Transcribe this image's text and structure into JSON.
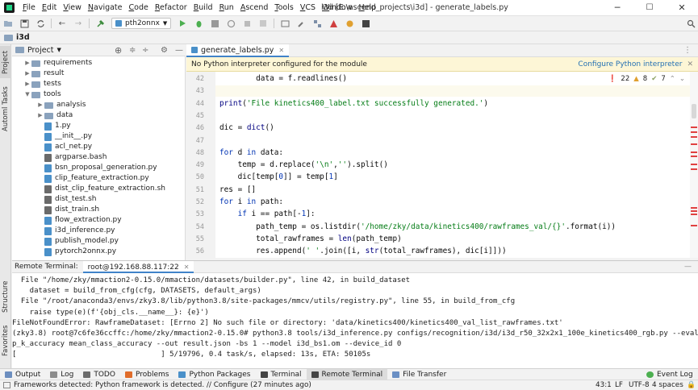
{
  "window": {
    "title": "i3d [E:\\ascend_projects\\i3d] - generate_labels.py",
    "menu": [
      "File",
      "Edit",
      "View",
      "Navigate",
      "Code",
      "Refactor",
      "Build",
      "Run",
      "Ascend",
      "Tools",
      "VCS",
      "Window",
      "Help"
    ],
    "minimize": "─",
    "maximize": "☐",
    "close": "✕"
  },
  "toolbar": {
    "run_config": "pth2onnx"
  },
  "breadcrumb": "i3d",
  "project_panel": {
    "title": "Project",
    "tree": [
      {
        "label": "requirements",
        "type": "folder",
        "indent": 1,
        "expanded": false
      },
      {
        "label": "result",
        "type": "folder",
        "indent": 1,
        "expanded": false
      },
      {
        "label": "tests",
        "type": "folder",
        "indent": 1,
        "expanded": false
      },
      {
        "label": "tools",
        "type": "folder",
        "indent": 1,
        "expanded": true
      },
      {
        "label": "analysis",
        "type": "folder",
        "indent": 2,
        "expanded": false
      },
      {
        "label": "data",
        "type": "folder",
        "indent": 2,
        "expanded": false
      },
      {
        "label": "1.py",
        "type": "py",
        "indent": 2
      },
      {
        "label": "__init__.py",
        "type": "py",
        "indent": 2
      },
      {
        "label": "acl_net.py",
        "type": "py",
        "indent": 2
      },
      {
        "label": "argparse.bash",
        "type": "sh",
        "indent": 2
      },
      {
        "label": "bsn_proposal_generation.py",
        "type": "py",
        "indent": 2
      },
      {
        "label": "clip_feature_extraction.py",
        "type": "py",
        "indent": 2
      },
      {
        "label": "dist_clip_feature_extraction.sh",
        "type": "sh",
        "indent": 2
      },
      {
        "label": "dist_test.sh",
        "type": "sh",
        "indent": 2
      },
      {
        "label": "dist_train.sh",
        "type": "sh",
        "indent": 2
      },
      {
        "label": "flow_extraction.py",
        "type": "py",
        "indent": 2
      },
      {
        "label": "i3d_inference.py",
        "type": "py",
        "indent": 2
      },
      {
        "label": "publish_model.py",
        "type": "py",
        "indent": 2
      },
      {
        "label": "pytorch2onnx.py",
        "type": "py",
        "indent": 2
      }
    ]
  },
  "editor": {
    "tab": "generate_labels.py",
    "banner_text": "No Python interpreter configured for the module",
    "banner_link": "Configure Python interpreter",
    "inspections": {
      "errors": "22",
      "warnings": "8",
      "weak": "7"
    },
    "lines": [
      {
        "n": "42",
        "html": "        data = f.readlines()"
      },
      {
        "n": "43",
        "html": ""
      },
      {
        "n": "44",
        "html": "<span class=\"fn\">print</span>(<span class=\"str\">'File kinetics400_label.txt successfully generated.'</span>)"
      },
      {
        "n": "45",
        "html": ""
      },
      {
        "n": "46",
        "html": "dic = <span class=\"fn\">dict</span>()"
      },
      {
        "n": "47",
        "html": ""
      },
      {
        "n": "48",
        "html": "<span class=\"kw\">for</span> d <span class=\"kw\">in</span> data:"
      },
      {
        "n": "49",
        "html": "    temp = d.replace(<span class=\"str\">'\\n'</span>,<span class=\"str\">''</span>).split()"
      },
      {
        "n": "50",
        "html": "    dic[temp[<span class=\"kw\">0</span>]] = temp[<span class=\"kw\">1</span>]"
      },
      {
        "n": "51",
        "html": "res = []"
      },
      {
        "n": "52",
        "html": "<span class=\"kw\">for</span> i <span class=\"kw\">in</span> path:"
      },
      {
        "n": "53",
        "html": "    <span class=\"kw\">if</span> i == path[-<span class=\"kw\">1</span>]:"
      },
      {
        "n": "54",
        "html": "        path_temp = os.listdir(<span class=\"str\">'/home/zky/data/kinetics400/rawframes_val/{}'</span>.format(i))"
      },
      {
        "n": "55",
        "html": "        total_rawframes = <span class=\"fn\">len</span>(path_temp)"
      },
      {
        "n": "56",
        "html": "        res.append(<span class=\"str\">' '</span>.join([i, <span class=\"fn\">str</span>(total_rawframes), dic[i]]))"
      }
    ]
  },
  "terminal": {
    "label": "Remote Terminal:",
    "tab": "root@192.168.88.117:22",
    "lines": [
      "  File \"/home/zky/mmaction2-0.15.0/mmaction/datasets/builder.py\", line 42, in build_dataset",
      "    dataset = build_from_cfg(cfg, DATASETS, default_args)",
      "  File \"/root/anaconda3/envs/zky3.8/lib/python3.8/site-packages/mmcv/utils/registry.py\", line 55, in build_from_cfg",
      "    raise type(e)(f'{obj_cls.__name__}: {e}')",
      "FileNotFoundError: RawframeDataset: [Errno 2] No such file or directory: 'data/kinetics400/kinetics400_val_list_rawframes.txt'",
      "(zky3.8) root@7c6fe36ccffc:/home/zky/mmaction2-0.15.0# python3.8 tools/i3d_inference.py configs/recognition/i3d/i3d_r50_32x2x1_100e_kinetics400_rgb.py --eval to",
      "p_k_accuracy mean_class_accuracy --out result.json -bs 1 --model i3d_bs1.om --device_id 0",
      "[                                 ] 5/19796, 0.4 task/s, elapsed: 13s, ETA: 50105s"
    ]
  },
  "left_strip": {
    "project": "Project",
    "tasks": "Automl Tasks",
    "structure": "Structure",
    "favorites": "Favorites"
  },
  "bottom_tabs": [
    {
      "label": "Output",
      "color": "#6c8ebf"
    },
    {
      "label": "Log",
      "color": "#8c8c8c"
    },
    {
      "label": "TODO",
      "color": "#6c6c6c"
    },
    {
      "label": "Problems",
      "color": "#e06c2a"
    },
    {
      "label": "Python Packages",
      "color": "#4a90c9"
    },
    {
      "label": "Terminal",
      "color": "#444444"
    },
    {
      "label": "Remote Terminal",
      "color": "#444444",
      "active": true
    },
    {
      "label": "File Transfer",
      "color": "#6a8fc4"
    }
  ],
  "event_log": "Event Log",
  "status": {
    "message": "Frameworks detected: Python framework is detected. // Configure (27 minutes ago)",
    "position": "43:1",
    "line_sep": "LF",
    "encoding": "UTF-8",
    "indent": "4 spaces"
  }
}
